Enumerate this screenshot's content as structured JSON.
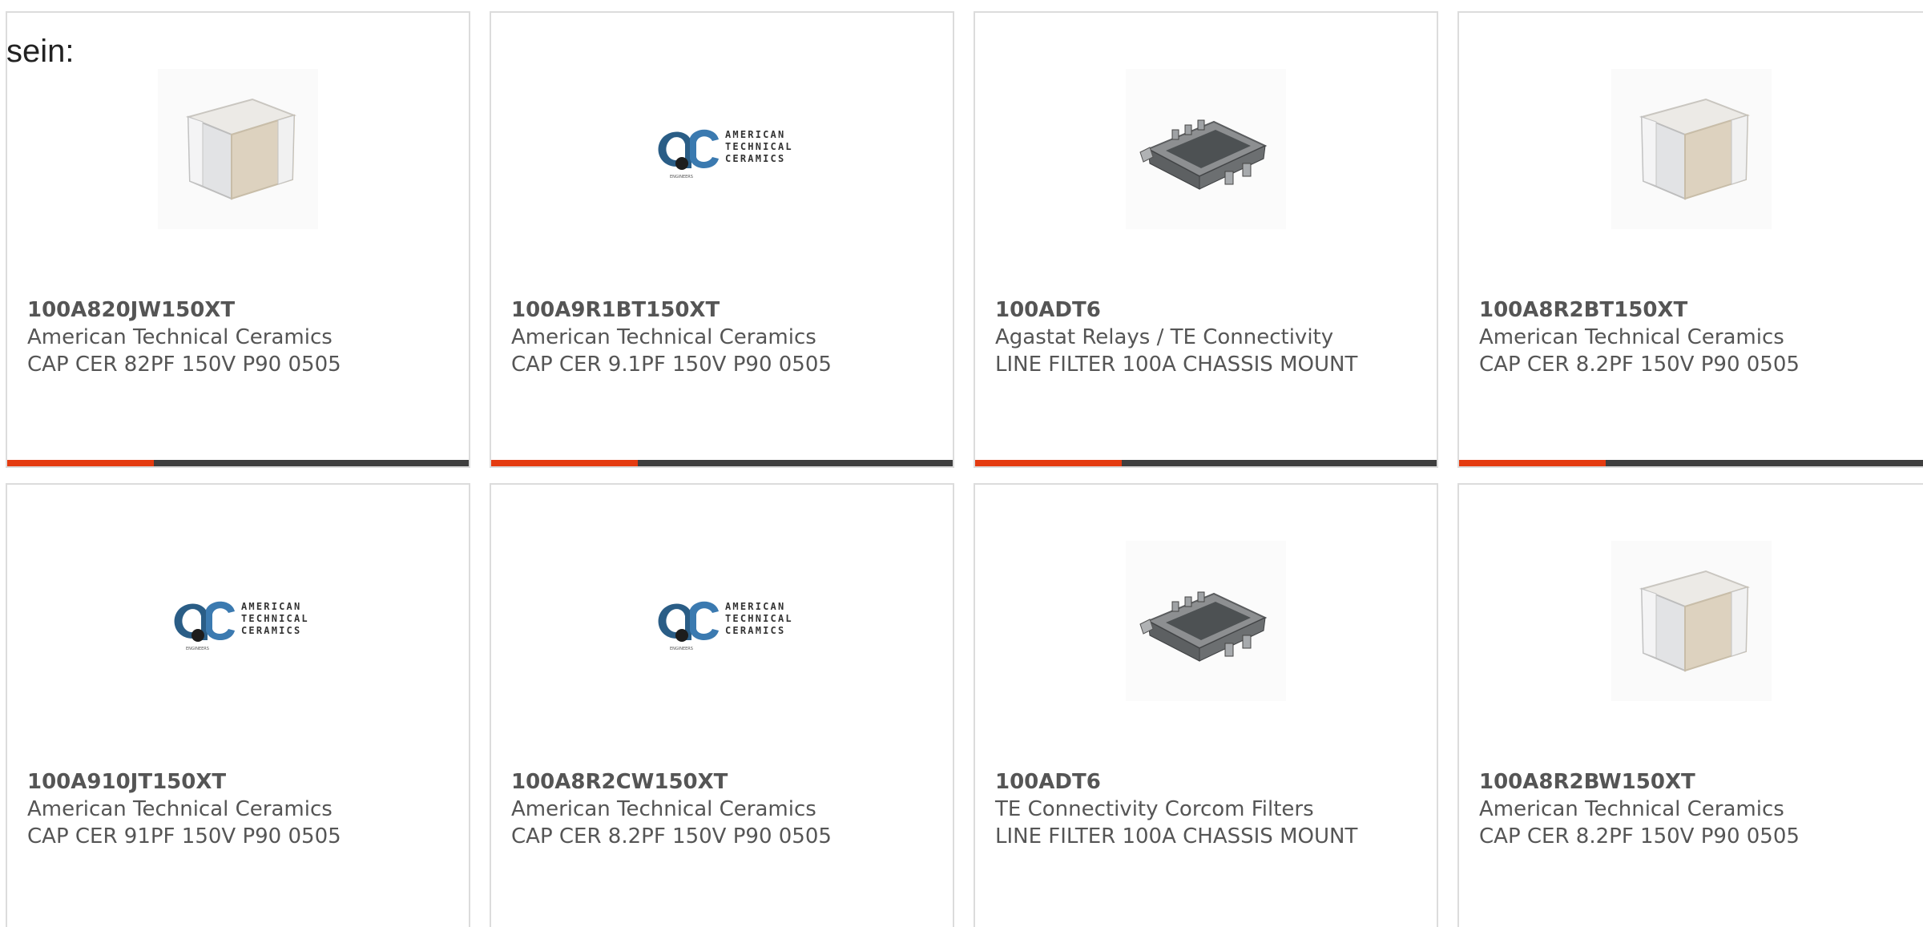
{
  "heading": "sein:",
  "accent_color": "#e43b10",
  "bar_color": "#3f3f3f",
  "products": [
    {
      "part_number": "100A820JW150XT",
      "manufacturer": "American Technical Ceramics",
      "description": "CAP CER 82PF 150V P90 0505",
      "image": "capacitor-cube"
    },
    {
      "part_number": "100A9R1BT150XT",
      "manufacturer": "American Technical Ceramics",
      "description": "CAP CER 9.1PF 150V P90 0505",
      "image": "atc-logo"
    },
    {
      "part_number": "100ADT6",
      "manufacturer": "Agastat Relays / TE Connectivity",
      "description": "LINE FILTER 100A CHASSIS MOUNT",
      "image": "line-filter"
    },
    {
      "part_number": "100A8R2BT150XT",
      "manufacturer": "American Technical Ceramics",
      "description": "CAP CER 8.2PF 150V P90 0505",
      "image": "capacitor-cube"
    },
    {
      "part_number": "100A910JT150XT",
      "manufacturer": "American Technical Ceramics",
      "description": "CAP CER 91PF 150V P90 0505",
      "image": "atc-logo"
    },
    {
      "part_number": "100A8R2CW150XT",
      "manufacturer": "American Technical Ceramics",
      "description": "CAP CER 8.2PF 150V P90 0505",
      "image": "atc-logo"
    },
    {
      "part_number": "100ADT6",
      "manufacturer": "TE Connectivity Corcom Filters",
      "description": "LINE FILTER 100A CHASSIS MOUNT",
      "image": "line-filter"
    },
    {
      "part_number": "100A8R2BW150XT",
      "manufacturer": "American Technical Ceramics",
      "description": "CAP CER 8.2PF 150V P90 0505",
      "image": "capacitor-cube"
    }
  ],
  "logo_text": {
    "line1": "AMERICAN",
    "line2": "TECHNICAL",
    "line3": "CERAMICS"
  }
}
